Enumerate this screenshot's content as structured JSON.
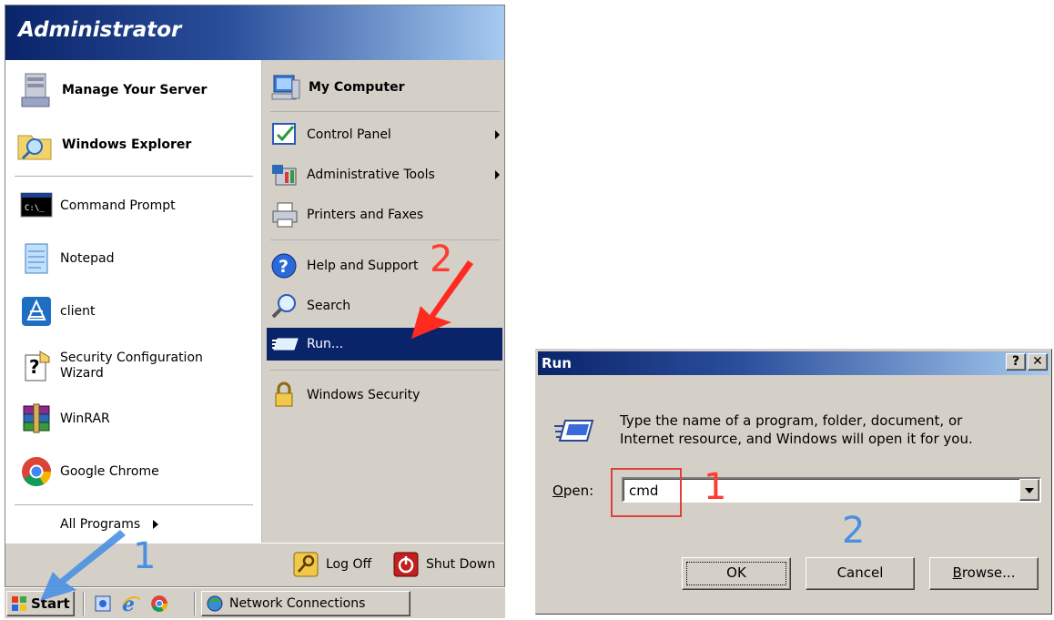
{
  "start_menu": {
    "user": "Administrator",
    "pinned": [
      {
        "label": "Manage Your Server"
      },
      {
        "label": "Windows Explorer"
      }
    ],
    "recent": [
      {
        "label": "Command Prompt"
      },
      {
        "label": "Notepad"
      },
      {
        "label": "client"
      },
      {
        "label_line1": "Security Configuration",
        "label_line2": "Wizard"
      },
      {
        "label": "WinRAR"
      },
      {
        "label": "Google Chrome"
      }
    ],
    "all_programs": "All Programs",
    "right": {
      "my_computer": "My Computer",
      "control_panel": "Control Panel",
      "admin_tools": "Administrative Tools",
      "printers": "Printers and Faxes",
      "help": "Help and Support",
      "search": "Search",
      "run": "Run...",
      "windows_security": "Windows Security"
    },
    "log_off": "Log Off",
    "shut_down": "Shut Down"
  },
  "taskbar": {
    "start": "Start",
    "task_button": "Network Connections"
  },
  "run_dialog": {
    "title": "Run",
    "help_btn": "?",
    "close_btn": "✕",
    "description_line1": "Type the name of a program, folder, document, or",
    "description_line2": "Internet resource, and Windows will open it for you.",
    "open_label": "Open:",
    "open_value": "cmd",
    "ok": "OK",
    "cancel": "Cancel",
    "browse": "Browse..."
  },
  "annotations": {
    "menu_step1": "1",
    "menu_step2": "2",
    "dialog_step1": "1",
    "dialog_step2": "2"
  },
  "colors": {
    "selection": "#0a246a",
    "face": "#d4d0c8",
    "annotation_red": "#ff3b30",
    "annotation_blue": "#4a90e2"
  }
}
